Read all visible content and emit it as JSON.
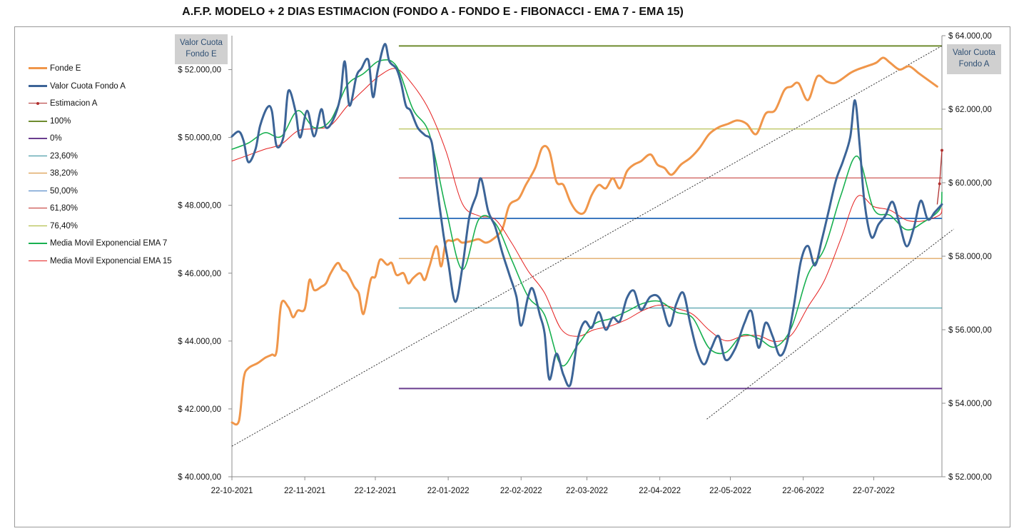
{
  "chart_data": {
    "type": "line",
    "title": "A.F.P. MODELO + 2 DIAS ESTIMACION (FONDO A - FONDO E - FIBONACCI - EMA 7 - EMA 15)",
    "y_left_label": [
      "Valor Cuota",
      "Fondo E"
    ],
    "y_right_label": [
      "Valor Cuota",
      "Fondo A"
    ],
    "ylim_left": [
      40000,
      53000
    ],
    "ylim_right": [
      52000,
      64000
    ],
    "y_left_ticks": [
      "$ 40.000,00",
      "$ 42.000,00",
      "$ 44.000,00",
      "$ 46.000,00",
      "$ 48.000,00",
      "$ 50.000,00",
      "$ 52.000,00"
    ],
    "y_right_ticks": [
      "$ 52.000,00",
      "$ 54.000,00",
      "$ 56.000,00",
      "$ 58.000,00",
      "$ 60.000,00",
      "$ 62.000,00",
      "$ 64.000,00"
    ],
    "x_ticks": [
      "22-10-2021",
      "22-11-2021",
      "22-12-2021",
      "22-01-2022",
      "22-02-2022",
      "22-03-2022",
      "22-04-2022",
      "22-05-2022",
      "22-06-2022",
      "22-07-2022"
    ],
    "x_start": "2021-10-22",
    "x_end": "2022-08-20",
    "legend": [
      "Fonde E",
      "Valor Cuota Fondo A",
      "Estimacion A",
      "100%",
      "0%",
      "23,60%",
      "38,20%",
      "50,00%",
      "61,80%",
      "76,40%",
      "Media Movil Exponencial  EMA 7",
      "Media Movil Exponencial EMA 15"
    ],
    "colors": {
      "fondo_e": "#f0964a",
      "fondo_a": "#3c6497",
      "estimacion": "#b0302f",
      "fib_100": "#6e8b2e",
      "fib_0": "#6a3d8f",
      "fib_2360": "#2e8d9a",
      "fib_3820": "#d58a2d",
      "fib_5000": "#3d79c0",
      "fib_6180": "#c0302b",
      "fib_7640": "#a6b42e",
      "ema7": "#18b050",
      "ema15": "#e52020"
    },
    "fibonacci": {
      "start_date": "2022-01-01",
      "levels_right_axis": [
        {
          "name": "100%",
          "value": 63720
        },
        {
          "name": "76,40%",
          "value": 61460
        },
        {
          "name": "61,80%",
          "value": 60130
        },
        {
          "name": "50,00%",
          "value": 59030
        },
        {
          "name": "38,20%",
          "value": 57940
        },
        {
          "name": "23,60%",
          "value": 56590
        },
        {
          "name": "0%",
          "value": 54400
        }
      ]
    },
    "trendlines_left_axis": [
      {
        "from": [
          "2021-10-22",
          40900
        ],
        "to": [
          "2022-08-20",
          52700
        ]
      },
      {
        "from": [
          "2022-05-12",
          41700
        ],
        "to": [
          "2022-08-25",
          47300
        ]
      }
    ],
    "fondo_e_left_axis": [
      [
        "2021-10-22",
        41600
      ],
      [
        "2021-10-25",
        41650
      ],
      [
        "2021-10-27",
        42900
      ],
      [
        "2021-10-29",
        43200
      ],
      [
        "2021-11-02",
        43350
      ],
      [
        "2021-11-05",
        43500
      ],
      [
        "2021-11-08",
        43600
      ],
      [
        "2021-11-10",
        43700
      ],
      [
        "2021-11-12",
        45100
      ],
      [
        "2021-11-15",
        45000
      ],
      [
        "2021-11-17",
        44700
      ],
      [
        "2021-11-19",
        44900
      ],
      [
        "2021-11-22",
        44950
      ],
      [
        "2021-11-24",
        45800
      ],
      [
        "2021-11-26",
        45500
      ],
      [
        "2021-11-29",
        45600
      ],
      [
        "2021-12-01",
        45700
      ],
      [
        "2021-12-03",
        46000
      ],
      [
        "2021-12-06",
        46300
      ],
      [
        "2021-12-08",
        46100
      ],
      [
        "2021-12-10",
        46000
      ],
      [
        "2021-12-13",
        45600
      ],
      [
        "2021-12-15",
        45400
      ],
      [
        "2021-12-17",
        44800
      ],
      [
        "2021-12-20",
        45800
      ],
      [
        "2021-12-22",
        45900
      ],
      [
        "2021-12-24",
        46400
      ],
      [
        "2021-12-27",
        46250
      ],
      [
        "2021-12-29",
        46300
      ],
      [
        "2021-12-31",
        45950
      ],
      [
        "2022-01-03",
        46000
      ],
      [
        "2022-01-05",
        45700
      ],
      [
        "2022-01-07",
        45850
      ],
      [
        "2022-01-10",
        46000
      ],
      [
        "2022-01-12",
        45800
      ],
      [
        "2022-01-14",
        46200
      ],
      [
        "2022-01-17",
        46800
      ],
      [
        "2022-01-19",
        46200
      ],
      [
        "2022-01-21",
        46900
      ],
      [
        "2022-01-24",
        46950
      ],
      [
        "2022-01-26",
        47000
      ],
      [
        "2022-01-28",
        46900
      ],
      [
        "2022-02-01",
        46950
      ],
      [
        "2022-02-04",
        47000
      ],
      [
        "2022-02-07",
        46900
      ],
      [
        "2022-02-10",
        47000
      ],
      [
        "2022-02-14",
        47300
      ],
      [
        "2022-02-17",
        48000
      ],
      [
        "2022-02-21",
        48200
      ],
      [
        "2022-02-24",
        48600
      ],
      [
        "2022-02-28",
        49100
      ],
      [
        "2022-03-03",
        49700
      ],
      [
        "2022-03-06",
        49600
      ],
      [
        "2022-03-09",
        48700
      ],
      [
        "2022-03-12",
        48600
      ],
      [
        "2022-03-15",
        48100
      ],
      [
        "2022-03-18",
        47800
      ],
      [
        "2022-03-21",
        47800
      ],
      [
        "2022-03-24",
        48300
      ],
      [
        "2022-03-27",
        48600
      ],
      [
        "2022-03-30",
        48500
      ],
      [
        "2022-04-02",
        48800
      ],
      [
        "2022-04-05",
        48500
      ],
      [
        "2022-04-08",
        49000
      ],
      [
        "2022-04-11",
        49200
      ],
      [
        "2022-04-14",
        49300
      ],
      [
        "2022-04-18",
        49500
      ],
      [
        "2022-04-21",
        49200
      ],
      [
        "2022-04-24",
        49100
      ],
      [
        "2022-04-27",
        48900
      ],
      [
        "2022-05-01",
        49200
      ],
      [
        "2022-05-05",
        49400
      ],
      [
        "2022-05-09",
        49700
      ],
      [
        "2022-05-13",
        50100
      ],
      [
        "2022-05-17",
        50300
      ],
      [
        "2022-05-21",
        50400
      ],
      [
        "2022-05-25",
        50500
      ],
      [
        "2022-05-29",
        50400
      ],
      [
        "2022-06-02",
        50100
      ],
      [
        "2022-06-06",
        50700
      ],
      [
        "2022-06-10",
        50800
      ],
      [
        "2022-06-14",
        51400
      ],
      [
        "2022-06-17",
        51500
      ],
      [
        "2022-06-20",
        51600
      ],
      [
        "2022-06-24",
        51100
      ],
      [
        "2022-06-28",
        51800
      ],
      [
        "2022-07-02",
        51650
      ],
      [
        "2022-07-05",
        51600
      ],
      [
        "2022-07-08",
        51700
      ],
      [
        "2022-07-12",
        51900
      ],
      [
        "2022-07-15",
        52000
      ],
      [
        "2022-07-19",
        52100
      ],
      [
        "2022-07-23",
        52200
      ],
      [
        "2022-07-26",
        52350
      ],
      [
        "2022-07-29",
        52200
      ],
      [
        "2022-08-02",
        52000
      ],
      [
        "2022-08-06",
        52100
      ],
      [
        "2022-08-10",
        51900
      ],
      [
        "2022-08-14",
        51700
      ],
      [
        "2022-08-18",
        51500
      ]
    ],
    "fondo_a_right_axis": [
      [
        "2021-10-22",
        61260
      ],
      [
        "2021-10-25",
        61390
      ],
      [
        "2021-10-27",
        61130
      ],
      [
        "2021-10-29",
        60560
      ],
      [
        "2021-11-01",
        60900
      ],
      [
        "2021-11-03",
        61550
      ],
      [
        "2021-11-06",
        62040
      ],
      [
        "2021-11-08",
        61950
      ],
      [
        "2021-11-10",
        61000
      ],
      [
        "2021-11-13",
        61270
      ],
      [
        "2021-11-15",
        62500
      ],
      [
        "2021-11-18",
        61960
      ],
      [
        "2021-11-20",
        61230
      ],
      [
        "2021-11-23",
        61960
      ],
      [
        "2021-11-26",
        61260
      ],
      [
        "2021-11-29",
        62000
      ],
      [
        "2021-12-01",
        61500
      ],
      [
        "2021-12-04",
        61700
      ],
      [
        "2021-12-07",
        62300
      ],
      [
        "2021-12-09",
        63300
      ],
      [
        "2021-12-11",
        62100
      ],
      [
        "2021-12-14",
        62900
      ],
      [
        "2021-12-16",
        63100
      ],
      [
        "2021-12-19",
        63340
      ],
      [
        "2021-12-21",
        62330
      ],
      [
        "2021-12-23",
        63050
      ],
      [
        "2021-12-26",
        63770
      ],
      [
        "2021-12-28",
        63300
      ],
      [
        "2021-12-31",
        63100
      ],
      [
        "2022-01-02",
        62700
      ],
      [
        "2022-01-04",
        62100
      ],
      [
        "2022-01-06",
        61960
      ],
      [
        "2022-01-09",
        61500
      ],
      [
        "2022-01-12",
        61300
      ],
      [
        "2022-01-15",
        61100
      ],
      [
        "2022-01-17",
        60000
      ],
      [
        "2022-01-20",
        58580
      ],
      [
        "2022-01-22",
        57840
      ],
      [
        "2022-01-25",
        56760
      ],
      [
        "2022-01-28",
        57690
      ],
      [
        "2022-01-31",
        59080
      ],
      [
        "2022-02-03",
        59660
      ],
      [
        "2022-02-05",
        60110
      ],
      [
        "2022-02-08",
        59230
      ],
      [
        "2022-02-11",
        58800
      ],
      [
        "2022-02-14",
        58100
      ],
      [
        "2022-02-17",
        57500
      ],
      [
        "2022-02-20",
        56900
      ],
      [
        "2022-02-22",
        56110
      ],
      [
        "2022-02-25",
        56900
      ],
      [
        "2022-02-27",
        57110
      ],
      [
        "2022-03-02",
        56400
      ],
      [
        "2022-03-04",
        55900
      ],
      [
        "2022-03-06",
        54650
      ],
      [
        "2022-03-09",
        55350
      ],
      [
        "2022-03-12",
        54770
      ],
      [
        "2022-03-15",
        54510
      ],
      [
        "2022-03-18",
        55710
      ],
      [
        "2022-03-21",
        56220
      ],
      [
        "2022-03-24",
        56050
      ],
      [
        "2022-03-27",
        56480
      ],
      [
        "2022-03-30",
        56000
      ],
      [
        "2022-04-02",
        56330
      ],
      [
        "2022-04-05",
        56230
      ],
      [
        "2022-04-08",
        56860
      ],
      [
        "2022-04-11",
        57060
      ],
      [
        "2022-04-14",
        56540
      ],
      [
        "2022-04-18",
        56900
      ],
      [
        "2022-04-22",
        56850
      ],
      [
        "2022-04-26",
        56100
      ],
      [
        "2022-04-29",
        56700
      ],
      [
        "2022-05-02",
        57000
      ],
      [
        "2022-05-05",
        56150
      ],
      [
        "2022-05-08",
        55400
      ],
      [
        "2022-05-11",
        55060
      ],
      [
        "2022-05-14",
        55510
      ],
      [
        "2022-05-17",
        55830
      ],
      [
        "2022-05-20",
        55180
      ],
      [
        "2022-05-24",
        55480
      ],
      [
        "2022-05-28",
        56180
      ],
      [
        "2022-05-31",
        56500
      ],
      [
        "2022-06-03",
        55510
      ],
      [
        "2022-06-06",
        56190
      ],
      [
        "2022-06-09",
        55820
      ],
      [
        "2022-06-12",
        55300
      ],
      [
        "2022-06-15",
        55630
      ],
      [
        "2022-06-18",
        56640
      ],
      [
        "2022-06-21",
        57860
      ],
      [
        "2022-06-24",
        58280
      ],
      [
        "2022-06-27",
        57750
      ],
      [
        "2022-06-30",
        58470
      ],
      [
        "2022-07-03",
        59280
      ],
      [
        "2022-07-06",
        60080
      ],
      [
        "2022-07-09",
        60600
      ],
      [
        "2022-07-12",
        61240
      ],
      [
        "2022-07-14",
        62240
      ],
      [
        "2022-07-16",
        61030
      ],
      [
        "2022-07-18",
        59500
      ],
      [
        "2022-07-21",
        58520
      ],
      [
        "2022-07-24",
        58860
      ],
      [
        "2022-07-27",
        59110
      ],
      [
        "2022-07-30",
        59480
      ],
      [
        "2022-08-02",
        58870
      ],
      [
        "2022-08-05",
        58270
      ],
      [
        "2022-08-08",
        58760
      ],
      [
        "2022-08-11",
        59510
      ],
      [
        "2022-08-14",
        59000
      ],
      [
        "2022-08-17",
        59200
      ],
      [
        "2022-08-20",
        59410
      ]
    ],
    "estimacion_a_right_axis": [
      [
        "2022-08-18",
        59410
      ],
      [
        "2022-08-19",
        59970
      ],
      [
        "2022-08-20",
        60880
      ]
    ],
    "ema7_right_axis": [
      [
        "2021-10-22",
        60910
      ],
      [
        "2021-10-29",
        61080
      ],
      [
        "2021-11-05",
        61360
      ],
      [
        "2021-11-12",
        61260
      ],
      [
        "2021-11-19",
        61960
      ],
      [
        "2021-11-26",
        61500
      ],
      [
        "2021-12-03",
        61700
      ],
      [
        "2021-12-10",
        62650
      ],
      [
        "2021-12-17",
        62970
      ],
      [
        "2021-12-24",
        63320
      ],
      [
        "2021-12-31",
        63170
      ],
      [
        "2022-01-07",
        62000
      ],
      [
        "2022-01-14",
        61320
      ],
      [
        "2022-01-21",
        59300
      ],
      [
        "2022-01-28",
        57640
      ],
      [
        "2022-02-04",
        59000
      ],
      [
        "2022-02-11",
        58900
      ],
      [
        "2022-02-18",
        57900
      ],
      [
        "2022-02-25",
        56900
      ],
      [
        "2022-03-04",
        56400
      ],
      [
        "2022-03-11",
        55040
      ],
      [
        "2022-03-18",
        55580
      ],
      [
        "2022-03-25",
        56150
      ],
      [
        "2022-04-01",
        56300
      ],
      [
        "2022-04-08",
        56500
      ],
      [
        "2022-04-15",
        56720
      ],
      [
        "2022-04-22",
        56770
      ],
      [
        "2022-04-29",
        56480
      ],
      [
        "2022-05-06",
        56320
      ],
      [
        "2022-05-13",
        55500
      ],
      [
        "2022-05-20",
        55380
      ],
      [
        "2022-05-27",
        55850
      ],
      [
        "2022-06-03",
        55760
      ],
      [
        "2022-06-10",
        55530
      ],
      [
        "2022-06-17",
        56060
      ],
      [
        "2022-06-24",
        57500
      ],
      [
        "2022-07-01",
        58210
      ],
      [
        "2022-07-08",
        59650
      ],
      [
        "2022-07-15",
        60720
      ],
      [
        "2022-07-22",
        59280
      ],
      [
        "2022-07-29",
        59110
      ],
      [
        "2022-08-05",
        58720
      ],
      [
        "2022-08-12",
        58920
      ],
      [
        "2022-08-19",
        59270
      ],
      [
        "2022-08-20",
        59740
      ]
    ],
    "ema15_right_axis": [
      [
        "2021-10-22",
        60590
      ],
      [
        "2021-10-29",
        60750
      ],
      [
        "2021-11-05",
        60910
      ],
      [
        "2021-11-12",
        61050
      ],
      [
        "2021-11-19",
        61410
      ],
      [
        "2021-11-26",
        61470
      ],
      [
        "2021-12-03",
        61560
      ],
      [
        "2021-12-10",
        62080
      ],
      [
        "2021-12-17",
        62520
      ],
      [
        "2021-12-24",
        62920
      ],
      [
        "2021-12-31",
        63100
      ],
      [
        "2022-01-07",
        62660
      ],
      [
        "2022-01-14",
        61960
      ],
      [
        "2022-01-21",
        60870
      ],
      [
        "2022-01-28",
        59430
      ],
      [
        "2022-02-04",
        59100
      ],
      [
        "2022-02-11",
        59000
      ],
      [
        "2022-02-18",
        58360
      ],
      [
        "2022-02-25",
        57600
      ],
      [
        "2022-03-04",
        57000
      ],
      [
        "2022-03-11",
        56020
      ],
      [
        "2022-03-18",
        55820
      ],
      [
        "2022-03-25",
        56000
      ],
      [
        "2022-04-01",
        56100
      ],
      [
        "2022-04-08",
        56280
      ],
      [
        "2022-04-15",
        56530
      ],
      [
        "2022-04-22",
        56670
      ],
      [
        "2022-04-29",
        56580
      ],
      [
        "2022-05-06",
        56420
      ],
      [
        "2022-05-13",
        55990
      ],
      [
        "2022-05-20",
        55700
      ],
      [
        "2022-05-27",
        55820
      ],
      [
        "2022-06-03",
        55840
      ],
      [
        "2022-06-10",
        55680
      ],
      [
        "2022-06-17",
        55860
      ],
      [
        "2022-06-24",
        56620
      ],
      [
        "2022-07-01",
        57340
      ],
      [
        "2022-07-08",
        58470
      ],
      [
        "2022-07-15",
        59620
      ],
      [
        "2022-07-22",
        59350
      ],
      [
        "2022-07-29",
        59250
      ],
      [
        "2022-08-05",
        58980
      ],
      [
        "2022-08-12",
        58960
      ],
      [
        "2022-08-19",
        59120
      ],
      [
        "2022-08-20",
        59300
      ]
    ]
  }
}
